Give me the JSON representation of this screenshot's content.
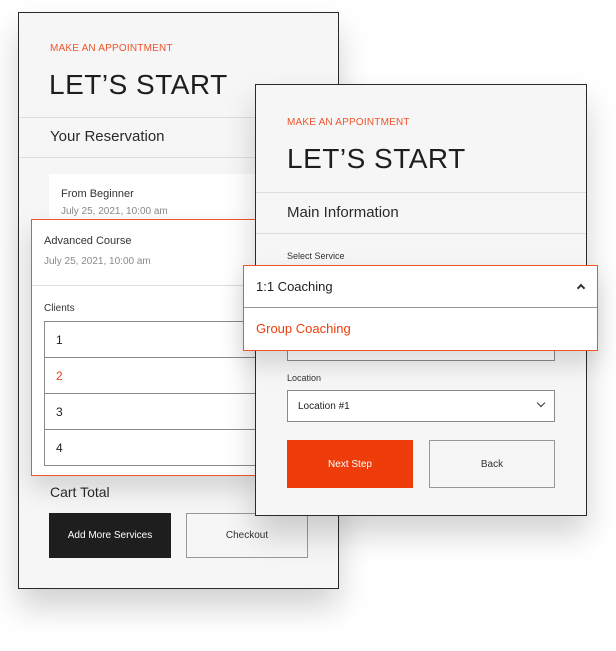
{
  "left": {
    "eyebrow": "MAKE AN APPOINTMENT",
    "title": "LET’S START",
    "section": "Your Reservation",
    "item1": {
      "name": "From Beginner",
      "date": "July 25, 2021, 10:00 am"
    },
    "item2": {
      "name": "Advanced Course",
      "date": "July 25, 2021, 10:00 am"
    },
    "clients_label": "Clients",
    "clients": [
      "1",
      "2",
      "3",
      "4"
    ],
    "selected_client": "2",
    "cart_total": "Cart Total",
    "add_more": "Add More Services",
    "checkout": "Checkout"
  },
  "right": {
    "eyebrow": "MAKE AN APPOINTMENT",
    "title": "LET’S START",
    "section": "Main Information",
    "service_label": "Select Service",
    "service_selected": "1:1 Coaching",
    "service_option": "Group Coaching",
    "location_label": "Location",
    "location_value": "Location #1",
    "next": "Next Step",
    "back": "Back"
  },
  "colors": {
    "accent": "#ee3d0a",
    "dark": "#1e1e1e",
    "bg": "#f6f6f6"
  }
}
